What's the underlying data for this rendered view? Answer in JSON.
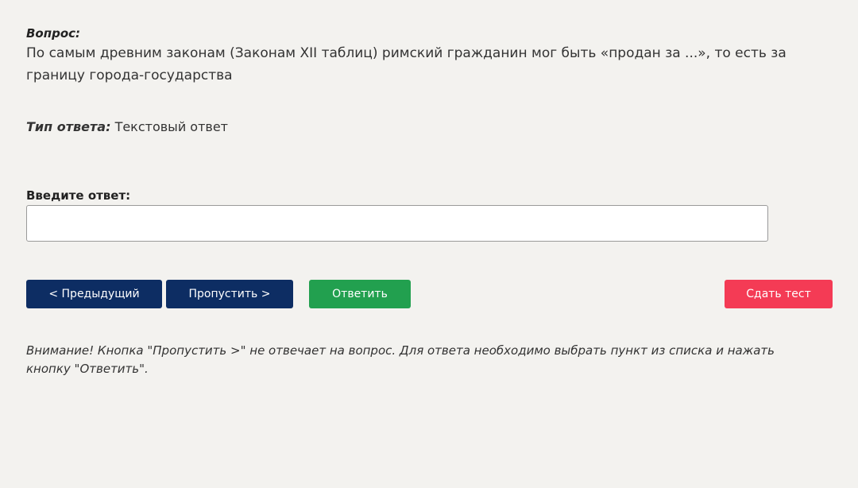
{
  "question": {
    "label": "Вопрос:",
    "text": "По самым древним законам (Законам XII таблиц) римский гражданин мог быть «продан за ...», то есть за границу города-государства"
  },
  "answer_type": {
    "label": "Тип ответа:",
    "value": "Текстовый ответ"
  },
  "answer_input": {
    "label": "Введите ответ:",
    "value": "",
    "placeholder": ""
  },
  "buttons": {
    "prev_label": "< Предыдущий",
    "skip_label": "Пропустить >",
    "answer_label": "Ответить",
    "submit_label": "Сдать тест"
  },
  "notice": "Внимание! Кнопка \"Пропустить >\" не отвечает на вопрос. Для ответа необходимо выбрать пункт из списка и нажать кнопку \"Ответить\".",
  "colors": {
    "background": "#f3f2ef",
    "nav_button": "#0d2d63",
    "answer_button": "#22a04f",
    "submit_button": "#f43b55"
  }
}
